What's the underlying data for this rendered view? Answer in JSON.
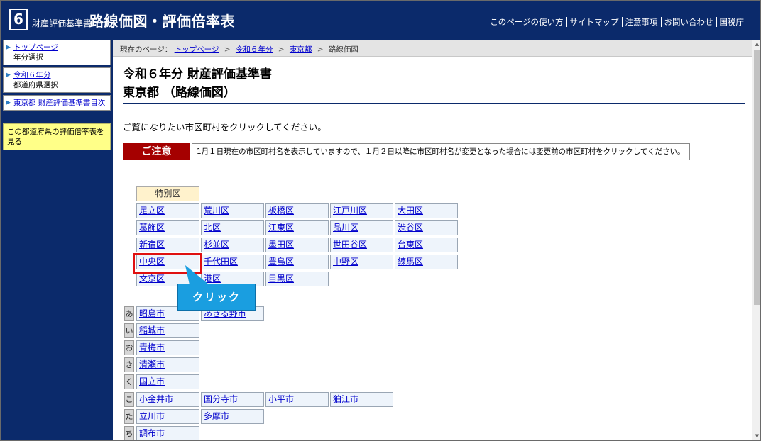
{
  "header": {
    "logo_num": "6",
    "logo_small": "財産評価基準書",
    "logo_big": "路線価図・評価倍率表",
    "links": [
      "このページの使い方",
      "サイトマップ",
      "注意事項",
      "お問い合わせ",
      "国税庁"
    ]
  },
  "sidebar": {
    "items": [
      {
        "label": "トップページ",
        "sub": "年分選択"
      },
      {
        "label": "令和６年分",
        "sub": "都道府県選択"
      },
      {
        "label": "東京都 財産評価基準書目次",
        "sub": ""
      }
    ],
    "note": "この都道府県の評価倍率表を見る"
  },
  "breadcrumb": {
    "prefix": "現在のページ：",
    "items": [
      "トップページ",
      "令和６年分",
      "東京都",
      "路線価図"
    ],
    "sep": ">"
  },
  "main": {
    "title1": "令和６年分  財産評価基準書",
    "title2": "東京都  （路線価図）",
    "instruction": "ご覧になりたい市区町村をクリックしてください。",
    "caution_label": "ご注意",
    "caution_text": "1月１日現在の市区町村名を表示していますので、１月２日以降に市区町村名が変更となった場合には変更前の市区町村をクリックしてください。"
  },
  "wards": {
    "header": "特別区",
    "rows": [
      [
        "足立区",
        "荒川区",
        "板橋区",
        "江戸川区",
        "大田区"
      ],
      [
        "葛飾区",
        "北区",
        "江東区",
        "品川区",
        "渋谷区"
      ],
      [
        "新宿区",
        "杉並区",
        "墨田区",
        "世田谷区",
        "台東区"
      ],
      [
        "中央区",
        "千代田区",
        "豊島区",
        "中野区",
        "練馬区"
      ],
      [
        "文京区",
        "港区",
        "目黒区"
      ]
    ]
  },
  "cities": [
    {
      "kana": "あ",
      "items": [
        "昭島市",
        "あきる野市"
      ]
    },
    {
      "kana": "い",
      "items": [
        "稲城市"
      ]
    },
    {
      "kana": "お",
      "items": [
        "青梅市"
      ]
    },
    {
      "kana": "き",
      "items": [
        "清瀬市"
      ]
    },
    {
      "kana": "く",
      "items": [
        "国立市"
      ]
    },
    {
      "kana": "こ",
      "items": [
        "小金井市",
        "国分寺市",
        "小平市",
        "狛江市"
      ]
    },
    {
      "kana": "た",
      "items": [
        "立川市",
        "多摩市"
      ]
    },
    {
      "kana": "ち",
      "items": [
        "調布市"
      ]
    }
  ],
  "callout": "クリック",
  "scrollbar": {
    "up": "▲",
    "down": "▼"
  }
}
